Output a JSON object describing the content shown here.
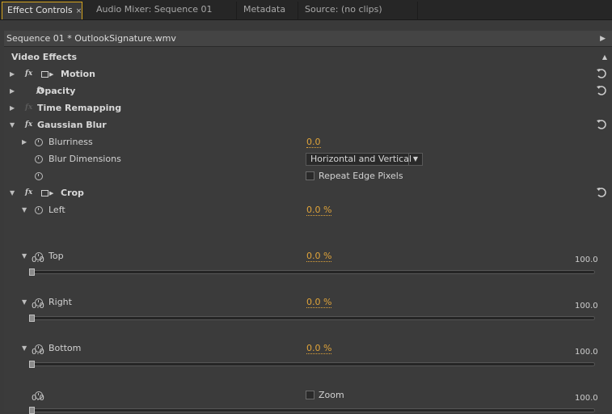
{
  "tabs": [
    {
      "label": "Effect Controls",
      "close": "×",
      "active": true
    },
    {
      "label": "Audio Mixer: Sequence 01",
      "active": false
    },
    {
      "label": "Metadata",
      "active": false
    },
    {
      "label": "Source: (no clips)",
      "active": false
    }
  ],
  "sequence_bar": {
    "title": "Sequence 01 * OutlookSignature.wmv",
    "arrow": "▶"
  },
  "section": {
    "title": "Video Effects",
    "collapse": "▲"
  },
  "effects": {
    "motion": {
      "name": "Motion"
    },
    "opacity": {
      "name": "Opacity"
    },
    "time_remapping": {
      "name": "Time Remapping"
    },
    "gaussian_blur": {
      "name": "Gaussian Blur",
      "blurriness": {
        "label": "Blurriness",
        "value": "0.0"
      },
      "blur_dimensions": {
        "label": "Blur Dimensions",
        "value": "Horizontal and Vertical"
      },
      "repeat_edge": {
        "label": "Repeat Edge Pixels",
        "checked": false
      }
    },
    "crop": {
      "name": "Crop",
      "left": {
        "label": "Left",
        "value": "0.0 %",
        "min": "0.0",
        "max": "100.0",
        "level": 0
      },
      "top": {
        "label": "Top",
        "value": "0.0 %",
        "min": "0.0",
        "max": "100.0",
        "level": 0
      },
      "right": {
        "label": "Right",
        "value": "0.0 %",
        "min": "0.0",
        "max": "100.0",
        "level": 0
      },
      "bottom": {
        "label": "Bottom",
        "value": "0.0 %",
        "min": "0.0",
        "max": "100.0",
        "level": 0
      },
      "zoom": {
        "label": "Zoom",
        "checked": false
      }
    }
  },
  "fx_glyph": "fx",
  "colors": {
    "accent": "#d4a31e",
    "value": "#e0a43a"
  }
}
